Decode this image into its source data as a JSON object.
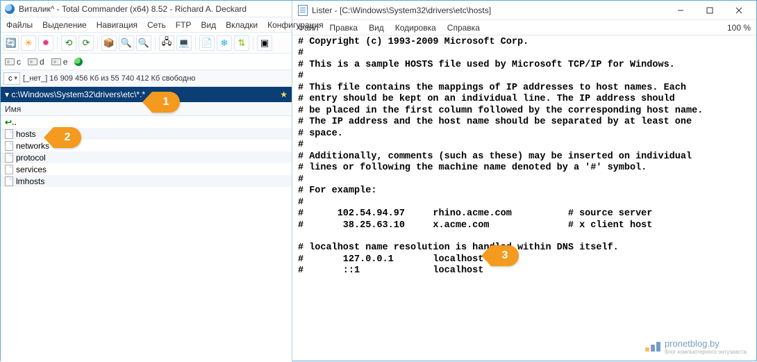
{
  "tc": {
    "title": "Виталик^ - Total Commander (x64) 8.52 - Richard A. Deckard",
    "menu": [
      "Файлы",
      "Выделение",
      "Навигация",
      "Сеть",
      "FTP",
      "Вид",
      "Вкладки",
      "Конфигурация"
    ],
    "drives": [
      "c",
      "d",
      "e"
    ],
    "drive_combo": "c",
    "space_text": "[_нет_]   16 909 456 Кб из 55 740 412 Кб свободно",
    "path": "▾ c:\\Windows\\System32\\drivers\\etc\\*.*",
    "column_header": "Имя",
    "files": [
      "hosts",
      "networks",
      "protocol",
      "services",
      "lmhosts"
    ]
  },
  "lister": {
    "title": "Lister - [C:\\Windows\\System32\\drivers\\etc\\hosts]",
    "menu": [
      "Файл",
      "Правка",
      "Вид",
      "Кодировка",
      "Справка"
    ],
    "percent": "100 %",
    "content": "# Copyright (c) 1993-2009 Microsoft Corp.\n#\n# This is a sample HOSTS file used by Microsoft TCP/IP for Windows.\n#\n# This file contains the mappings of IP addresses to host names. Each\n# entry should be kept on an individual line. The IP address should\n# be placed in the first column followed by the corresponding host name.\n# The IP address and the host name should be separated by at least one\n# space.\n#\n# Additionally, comments (such as these) may be inserted on individual\n# lines or following the machine name denoted by a '#' symbol.\n#\n# For example:\n#\n#      102.54.94.97     rhino.acme.com          # source server\n#       38.25.63.10     x.acme.com              # x client host\n\n# localhost name resolution is handled within DNS itself.\n#       127.0.0.1       localhost\n#       ::1             localhost"
  },
  "callouts": {
    "one": "1",
    "two": "2",
    "three": "3"
  },
  "watermark": {
    "name": "pronetblog.by",
    "tagline": "блог компьютерного энтузиаста"
  }
}
